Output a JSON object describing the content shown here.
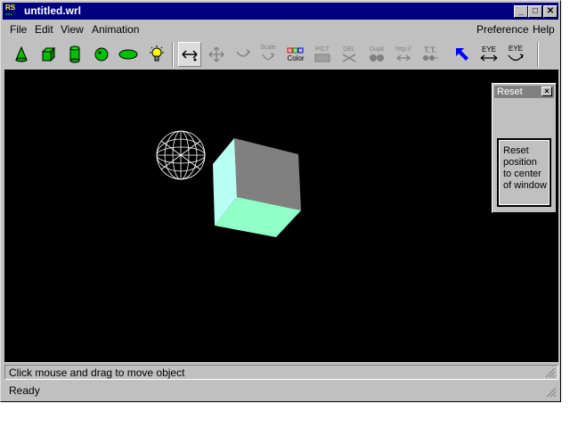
{
  "window": {
    "title": "untitled.wrl",
    "app_icon_top": "RS",
    "app_icon_bottom": "---"
  },
  "titlebar_buttons": {
    "minimize": "_",
    "maximize": "□",
    "close": "✕"
  },
  "menu": {
    "file": "File",
    "edit": "Edit",
    "view": "View",
    "animation": "Animation",
    "preference": "Preference",
    "help": "Help"
  },
  "toolbar": {
    "cone": "cone-icon",
    "cube": "cube-icon",
    "cylinder": "cylinder-icon",
    "sphere": "sphere-icon",
    "ellipse": "ellipse-icon",
    "light": "light-bulb-icon",
    "scale_label": "Scale",
    "color_label": "Color",
    "pict_label": "PICT",
    "del_label": "DEL",
    "dupli_label": "Dupli",
    "http_label": "http://",
    "tt_label": "T.T.",
    "eye1_label": "EYE",
    "eye2_label": "EYE"
  },
  "reset_panel": {
    "title": "Reset",
    "close": "×",
    "button_label": "Reset position to center of window"
  },
  "status": {
    "hint": "Click mouse and drag to move object",
    "state": "Ready"
  }
}
